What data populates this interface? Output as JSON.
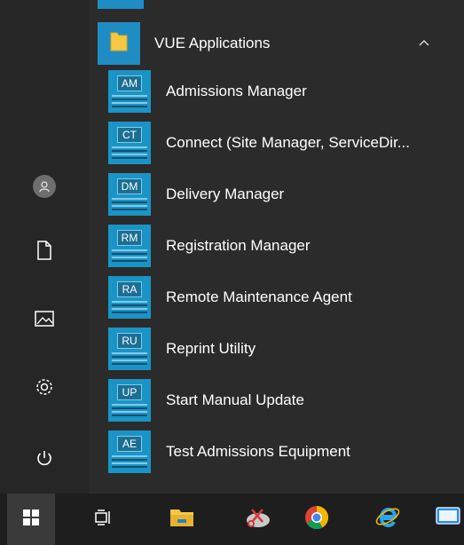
{
  "folder": {
    "label": "VUE Applications"
  },
  "apps": [
    {
      "abbr": "AM",
      "label": "Admissions Manager"
    },
    {
      "abbr": "CT",
      "label": "Connect (Site Manager, ServiceDir..."
    },
    {
      "abbr": "DM",
      "label": "Delivery Manager"
    },
    {
      "abbr": "RM",
      "label": "Registration Manager"
    },
    {
      "abbr": "RA",
      "label": "Remote Maintenance Agent"
    },
    {
      "abbr": "RU",
      "label": "Reprint Utility"
    },
    {
      "abbr": "UP",
      "label": "Start Manual Update"
    },
    {
      "abbr": "AE",
      "label": "Test Admissions Equipment"
    }
  ],
  "rail_icons": [
    "user-icon",
    "document-icon",
    "pictures-icon",
    "settings-icon",
    "power-icon"
  ],
  "taskbar_icons": [
    "windows-start-icon",
    "task-view-icon",
    "file-explorer-icon",
    "snipping-tool-icon",
    "chrome-icon",
    "internet-explorer-icon",
    "remote-desktop-icon"
  ],
  "colors": {
    "accent": "#1f8dc4",
    "tile": "#1a94c6",
    "background": "#2b2b2b",
    "taskbar": "#1e1e1e"
  }
}
